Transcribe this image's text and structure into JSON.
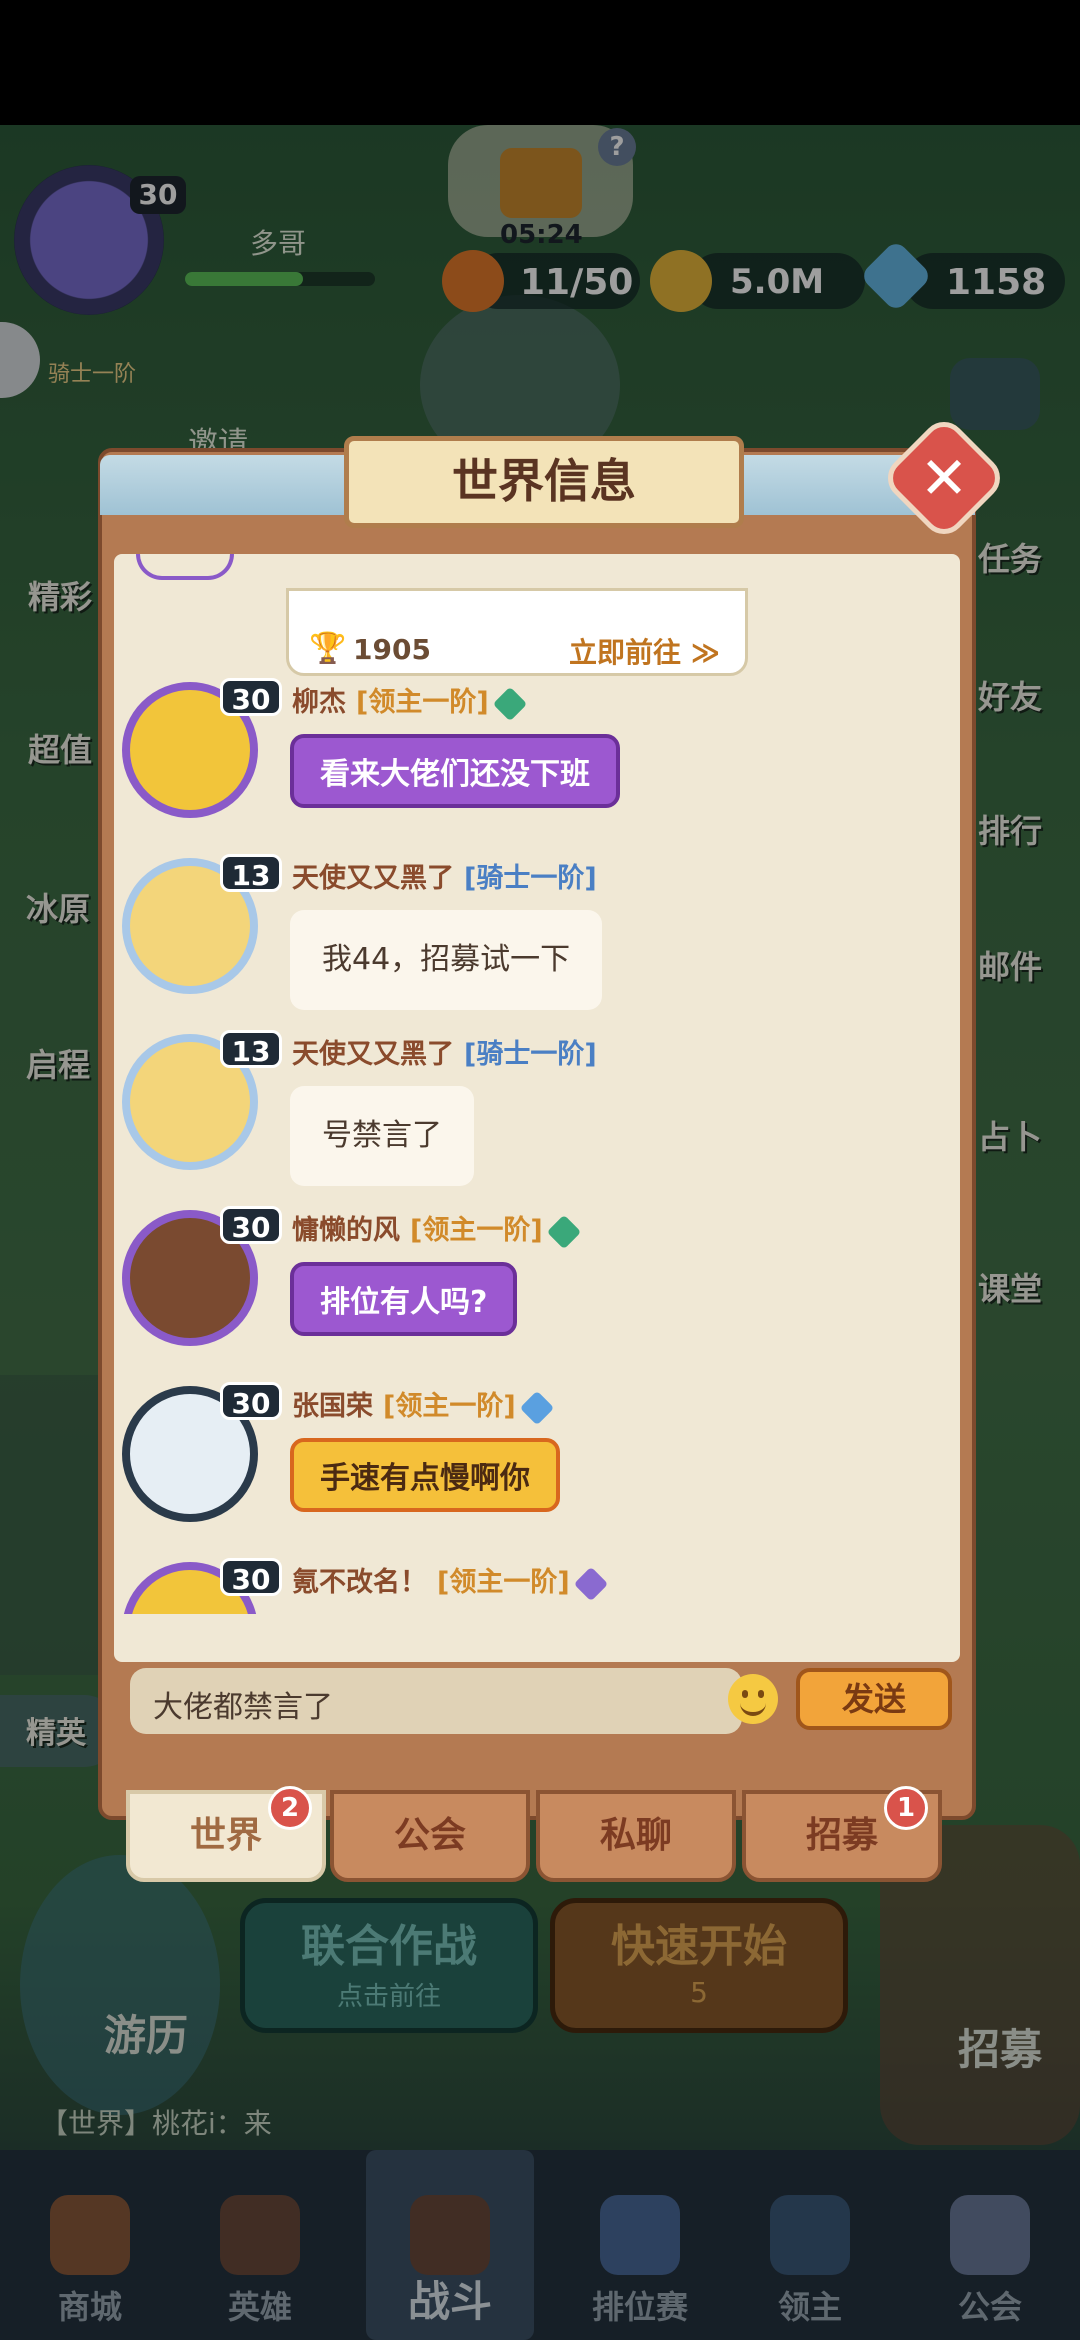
{
  "hud": {
    "level": "30",
    "player_name": "多哥",
    "rank": "骑士一阶",
    "invite": "邀请",
    "timer": "05:24",
    "energy": "11/50",
    "gold": "5.0M",
    "gems": "1158",
    "xp_fraction": 0.62
  },
  "side_menu": {
    "left": [
      "精彩",
      "超值",
      "冰原",
      "启程",
      "精英"
    ],
    "right": [
      "任务",
      "好友",
      "排行",
      "邮件",
      "占卜",
      "课堂"
    ]
  },
  "dialog": {
    "title": "世界信息",
    "close_glyph": "✕",
    "shared_card": {
      "trophy": "🏆",
      "score": "1905",
      "action": "立即前往 ≫"
    },
    "messages": [
      {
        "level": "30",
        "name": "柳杰",
        "rank": "[领主一阶]",
        "text": "看来大佬们还没下班",
        "bubble": "purple",
        "gem": "#3aa87a"
      },
      {
        "level": "13",
        "name": "天使又又黑了",
        "rank": "[骑士一阶]",
        "text": "我44，招募试一下",
        "bubble": "plain"
      },
      {
        "level": "13",
        "name": "天使又又黑了",
        "rank": "[骑士一阶]",
        "text": "号禁言了",
        "bubble": "plain"
      },
      {
        "level": "30",
        "name": "慵懒的风",
        "rank": "[领主一阶]",
        "text": "排位有人吗?",
        "bubble": "purple",
        "gem": "#3aa87a"
      },
      {
        "level": "30",
        "name": "张国荣",
        "rank": "[领主一阶]",
        "text": "手速有点慢啊你",
        "bubble": "gold",
        "gem": "#5aa0e0"
      },
      {
        "level": "30",
        "name": "氪不改名！",
        "rank": "[领主一阶]",
        "text": "",
        "bubble": "none",
        "gem": "#8a6ad0"
      }
    ],
    "input_value": "大佬都禁言了",
    "send_label": "发送",
    "tabs": [
      {
        "label": "世界",
        "badge": "2",
        "active": true
      },
      {
        "label": "公会",
        "badge": "",
        "active": false
      },
      {
        "label": "私聊",
        "badge": "",
        "active": false
      },
      {
        "label": "招募",
        "badge": "1",
        "active": false
      }
    ]
  },
  "game_buttons": {
    "coop_title": "联合作战",
    "coop_sub": "点击前往",
    "quick_title": "快速开始",
    "quick_cost": "5",
    "travel": "游历",
    "recruit": "招募",
    "world_ticker": "【世界】桃花i：来"
  },
  "bottom_nav": [
    {
      "label": "商城",
      "icon": "shop-chest-icon"
    },
    {
      "label": "英雄",
      "icon": "hero-card-icon"
    },
    {
      "label": "战斗",
      "icon": "crossed-swords-icon"
    },
    {
      "label": "排位赛",
      "icon": "rank-shield-icon"
    },
    {
      "label": "领主",
      "icon": "lord-banner-icon"
    },
    {
      "label": "公会",
      "icon": "guild-castle-icon"
    }
  ],
  "colors": {
    "dialog_wood": "#b47a52",
    "parchment": "#f0e8d5",
    "purple_bubble": "#9c58d0",
    "gold_bubble": "#f5c03a",
    "close_red": "#d9534b"
  }
}
